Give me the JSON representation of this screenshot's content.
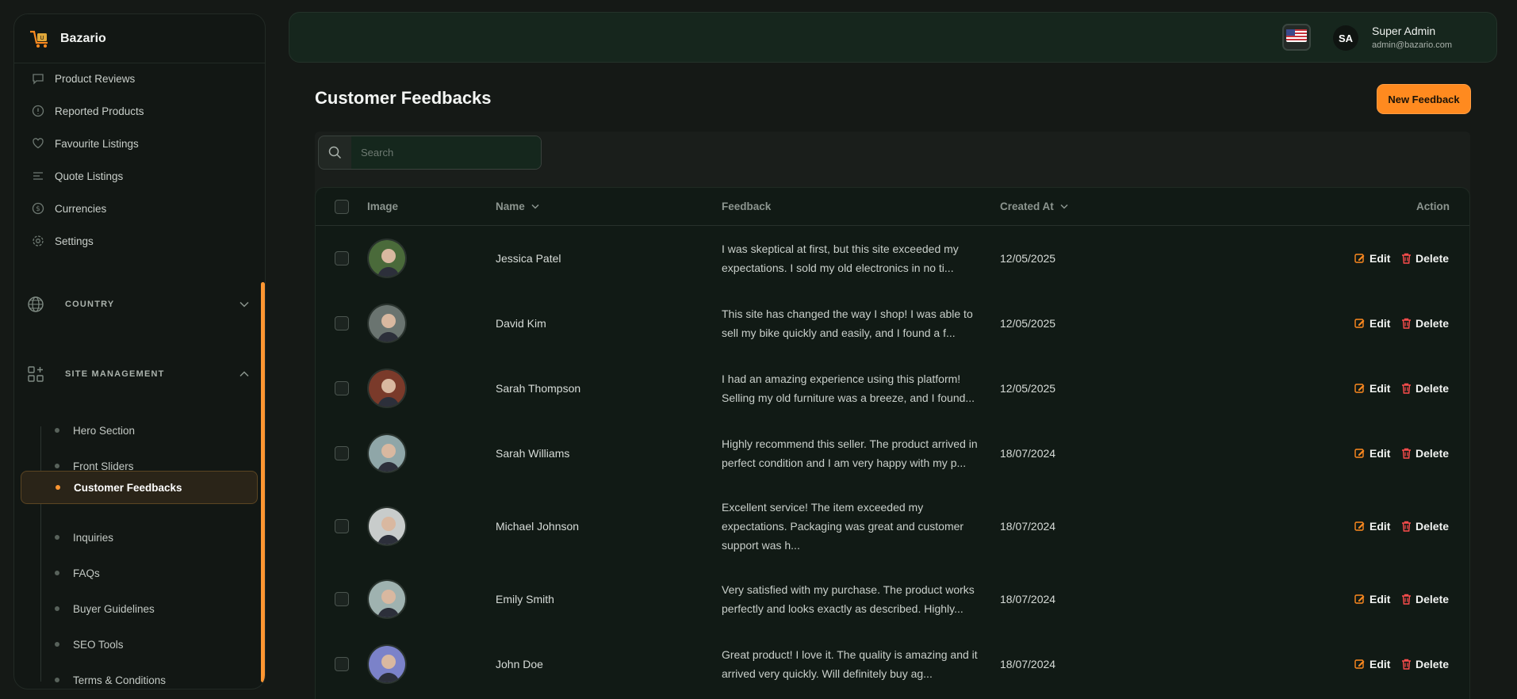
{
  "brand": {
    "name": "Bazario"
  },
  "sidebar": {
    "items": [
      {
        "label": "Product Reviews",
        "icon": "chat-icon"
      },
      {
        "label": "Reported Products",
        "icon": "alert-circle-icon"
      },
      {
        "label": "Favourite Listings",
        "icon": "heart-icon"
      },
      {
        "label": "Quote Listings",
        "icon": "list-icon"
      },
      {
        "label": "Currencies",
        "icon": "dollar-circle-icon"
      },
      {
        "label": "Settings",
        "icon": "gear-icon"
      }
    ],
    "groups": [
      {
        "label": "COUNTRY",
        "icon": "globe-icon",
        "expanded": false
      },
      {
        "label": "SITE MANAGEMENT",
        "icon": "apps-icon",
        "expanded": true
      }
    ],
    "site_management": [
      "Hero Section",
      "Front Sliders",
      "Customer Feedbacks",
      "Inquiries",
      "FAQs",
      "Buyer Guidelines",
      "SEO Tools",
      "Terms & Conditions"
    ],
    "active": "Customer Feedbacks"
  },
  "header": {
    "user_initials": "SA",
    "user_name": "Super Admin",
    "user_email": "admin@bazario.com",
    "language_flag": "us-flag-icon"
  },
  "page": {
    "title": "Customer Feedbacks",
    "new_button": "New Feedback",
    "search_placeholder": "Search"
  },
  "table": {
    "columns": [
      "Image",
      "Name",
      "Feedback",
      "Created At",
      "Action"
    ],
    "action_labels": {
      "edit": "Edit",
      "delete": "Delete"
    },
    "rows": [
      {
        "name": "Jessica Patel",
        "feedback_1": "I was skeptical at first, but this site exceeded my",
        "feedback_2": "expectations. I sold my old electronics in no ti...",
        "feedback_3": "",
        "created": "12/05/2025",
        "avatar_color": "#4a6a3a"
      },
      {
        "name": "David Kim",
        "feedback_1": "This site has changed the way I shop! I was able to",
        "feedback_2": "sell my bike quickly and easily, and I found a f...",
        "feedback_3": "",
        "created": "12/05/2025",
        "avatar_color": "#6a7470"
      },
      {
        "name": "Sarah Thompson",
        "feedback_1": "I had an amazing experience using this platform!",
        "feedback_2": "Selling my old furniture was a breeze, and I found...",
        "feedback_3": "",
        "created": "12/05/2025",
        "avatar_color": "#7a3a2a"
      },
      {
        "name": "Sarah Williams",
        "feedback_1": "Highly recommend this seller. The product arrived in",
        "feedback_2": "perfect condition and I am very happy with my p...",
        "feedback_3": "",
        "created": "18/07/2024",
        "avatar_color": "#8fa6a8"
      },
      {
        "name": "Michael Johnson",
        "feedback_1": "Excellent service! The item exceeded my",
        "feedback_2": "expectations. Packaging was great and customer",
        "feedback_3": "support was h...",
        "created": "18/07/2024",
        "avatar_color": "#c8cccb"
      },
      {
        "name": "Emily Smith",
        "feedback_1": "Very satisfied with my purchase. The product works",
        "feedback_2": "perfectly and looks exactly as described. Highly...",
        "feedback_3": "",
        "created": "18/07/2024",
        "avatar_color": "#9fb2b0"
      },
      {
        "name": "John Doe",
        "feedback_1": "Great product! I love it. The quality is amazing and it",
        "feedback_2": "arrived very quickly. Will definitely buy ag...",
        "feedback_3": "",
        "created": "18/07/2024",
        "avatar_color": "#7b82c9"
      }
    ]
  },
  "colors": {
    "accent": "#ff8a1f",
    "background": "#151916",
    "delete": "#ff4d4d"
  }
}
